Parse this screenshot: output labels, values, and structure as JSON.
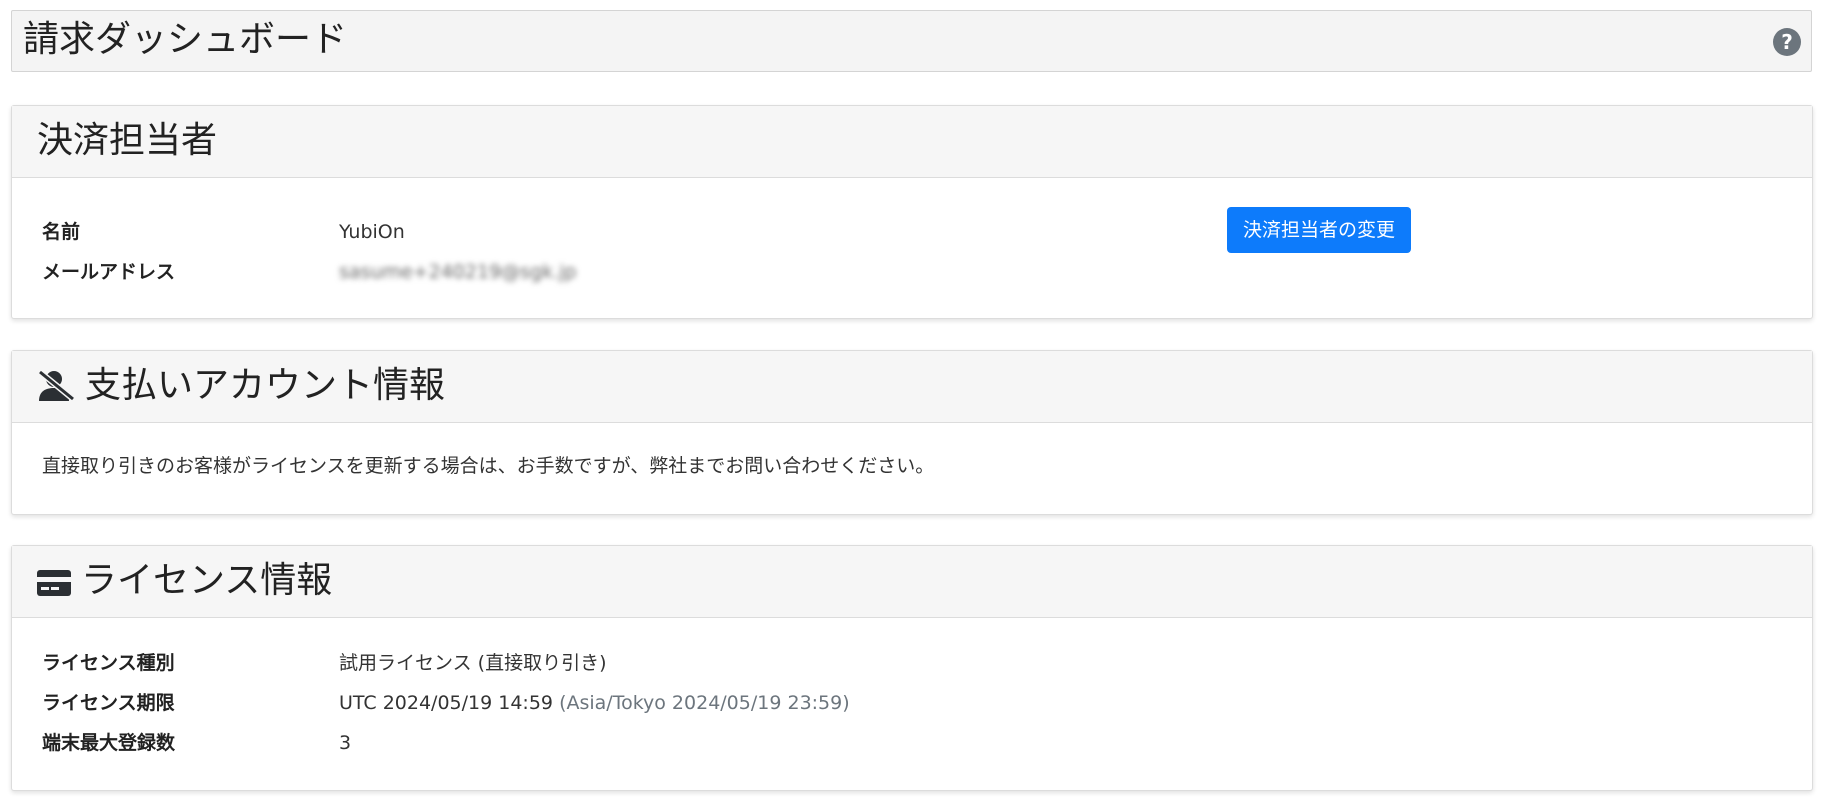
{
  "header": {
    "title": "請求ダッシュボード",
    "help_glyph": "?"
  },
  "payer": {
    "title": "決済担当者",
    "name_label": "名前",
    "name_value": "YubiOn",
    "email_label": "メールアドレス",
    "email_value": "sasume+240219@sgk.jp",
    "change_button": "決済担当者の変更"
  },
  "account": {
    "icon": "user-slash-icon",
    "title": "支払いアカウント情報",
    "description": "直接取り引きのお客様がライセンスを更新する場合は、お手数ですが、弊社までお問い合わせください。"
  },
  "license": {
    "icon": "credit-card-icon",
    "title": "ライセンス情報",
    "type_label": "ライセンス種別",
    "type_value": "試用ライセンス (直接取り引き)",
    "expiry_label": "ライセンス期限",
    "expiry_utc": "UTC 2024/05/19 14:59",
    "expiry_local": "(Asia/Tokyo 2024/05/19 23:59)",
    "devices_label": "端末最大登録数",
    "devices_value": "3"
  },
  "colors": {
    "primary": "#0d7bfb",
    "header_bg": "#f4f4f4",
    "muted": "#6c757d"
  }
}
